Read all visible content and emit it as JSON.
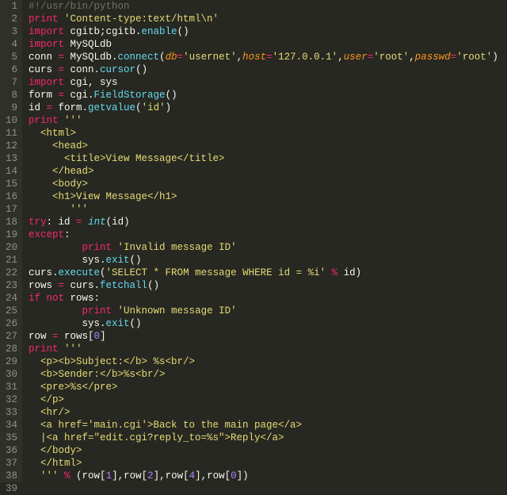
{
  "lines": [
    {
      "n": 1,
      "tokens": [
        [
          "c-comment",
          "#!/usr/bin/python"
        ]
      ]
    },
    {
      "n": 2,
      "tokens": [
        [
          "c-keyword",
          "print"
        ],
        [
          "c-default",
          " "
        ],
        [
          "c-string",
          "'Content-type:text/html\\n'"
        ]
      ]
    },
    {
      "n": 3,
      "tokens": [
        [
          "c-keyword",
          "import"
        ],
        [
          "c-default",
          " cgitb;cgitb."
        ],
        [
          "c-func",
          "enable"
        ],
        [
          "c-default",
          "()"
        ]
      ]
    },
    {
      "n": 4,
      "tokens": [
        [
          "c-keyword",
          "import"
        ],
        [
          "c-default",
          " MySQLdb"
        ]
      ]
    },
    {
      "n": 5,
      "tokens": [
        [
          "c-default",
          "conn "
        ],
        [
          "c-op",
          "="
        ],
        [
          "c-default",
          " MySQLdb."
        ],
        [
          "c-func",
          "connect"
        ],
        [
          "c-default",
          "("
        ],
        [
          "c-param",
          "db"
        ],
        [
          "c-op",
          "="
        ],
        [
          "c-string",
          "'usernet'"
        ],
        [
          "c-default",
          ","
        ],
        [
          "c-param",
          "host"
        ],
        [
          "c-op",
          "="
        ],
        [
          "c-string",
          "'127.0.0.1'"
        ],
        [
          "c-default",
          ","
        ],
        [
          "c-param",
          "user"
        ],
        [
          "c-op",
          "="
        ],
        [
          "c-string",
          "'root'"
        ],
        [
          "c-default",
          ","
        ],
        [
          "c-param",
          "passwd"
        ],
        [
          "c-op",
          "="
        ],
        [
          "c-string",
          "'root'"
        ],
        [
          "c-default",
          ")"
        ]
      ]
    },
    {
      "n": 6,
      "tokens": [
        [
          "c-default",
          "curs "
        ],
        [
          "c-op",
          "="
        ],
        [
          "c-default",
          " conn."
        ],
        [
          "c-func",
          "cursor"
        ],
        [
          "c-default",
          "()"
        ]
      ]
    },
    {
      "n": 7,
      "tokens": [
        [
          "c-keyword",
          "import"
        ],
        [
          "c-default",
          " cgi, sys"
        ]
      ]
    },
    {
      "n": 8,
      "tokens": [
        [
          "c-default",
          "form "
        ],
        [
          "c-op",
          "="
        ],
        [
          "c-default",
          " cgi."
        ],
        [
          "c-func",
          "FieldStorage"
        ],
        [
          "c-default",
          "()"
        ]
      ]
    },
    {
      "n": 9,
      "tokens": [
        [
          "c-default",
          "id "
        ],
        [
          "c-op",
          "="
        ],
        [
          "c-default",
          " form."
        ],
        [
          "c-func",
          "getvalue"
        ],
        [
          "c-default",
          "("
        ],
        [
          "c-string",
          "'id'"
        ],
        [
          "c-default",
          ")"
        ]
      ]
    },
    {
      "n": 10,
      "tokens": [
        [
          "c-keyword",
          "print"
        ],
        [
          "c-default",
          " "
        ],
        [
          "c-string",
          "'''"
        ]
      ]
    },
    {
      "n": 11,
      "tokens": [
        [
          "c-string",
          "  <html>"
        ]
      ]
    },
    {
      "n": 12,
      "tokens": [
        [
          "c-string",
          "    <head>"
        ]
      ]
    },
    {
      "n": 13,
      "tokens": [
        [
          "c-string",
          "      <title>View Message</title>"
        ]
      ]
    },
    {
      "n": 14,
      "tokens": [
        [
          "c-string",
          "    </head>"
        ]
      ]
    },
    {
      "n": 15,
      "tokens": [
        [
          "c-string",
          "    <body>"
        ]
      ]
    },
    {
      "n": 16,
      "tokens": [
        [
          "c-string",
          "    <h1>View Message</h1>"
        ]
      ]
    },
    {
      "n": 17,
      "tokens": [
        [
          "c-string",
          "       '''"
        ]
      ]
    },
    {
      "n": 18,
      "tokens": [
        [
          "c-keyword",
          "try"
        ],
        [
          "c-default",
          ": id "
        ],
        [
          "c-op",
          "="
        ],
        [
          "c-default",
          " "
        ],
        [
          "c-builtin",
          "int"
        ],
        [
          "c-default",
          "(id)"
        ]
      ]
    },
    {
      "n": 19,
      "tokens": [
        [
          "c-keyword",
          "except"
        ],
        [
          "c-default",
          ":"
        ]
      ]
    },
    {
      "n": 20,
      "tokens": [
        [
          "c-default",
          "         "
        ],
        [
          "c-keyword",
          "print"
        ],
        [
          "c-default",
          " "
        ],
        [
          "c-string",
          "'Invalid message ID'"
        ]
      ]
    },
    {
      "n": 21,
      "tokens": [
        [
          "c-default",
          "         sys."
        ],
        [
          "c-func",
          "exit"
        ],
        [
          "c-default",
          "()"
        ]
      ]
    },
    {
      "n": 22,
      "tokens": [
        [
          "c-default",
          "curs."
        ],
        [
          "c-func",
          "execute"
        ],
        [
          "c-default",
          "("
        ],
        [
          "c-string",
          "'SELECT * FROM message WHERE id = %i'"
        ],
        [
          "c-default",
          " "
        ],
        [
          "c-op",
          "%"
        ],
        [
          "c-default",
          " id)"
        ]
      ]
    },
    {
      "n": 23,
      "tokens": [
        [
          "c-default",
          "rows "
        ],
        [
          "c-op",
          "="
        ],
        [
          "c-default",
          " curs."
        ],
        [
          "c-func",
          "fetchall"
        ],
        [
          "c-default",
          "()"
        ]
      ]
    },
    {
      "n": 24,
      "tokens": [
        [
          "c-keyword",
          "if"
        ],
        [
          "c-default",
          " "
        ],
        [
          "c-keyword",
          "not"
        ],
        [
          "c-default",
          " rows:"
        ]
      ]
    },
    {
      "n": 25,
      "tokens": [
        [
          "c-default",
          "         "
        ],
        [
          "c-keyword",
          "print"
        ],
        [
          "c-default",
          " "
        ],
        [
          "c-string",
          "'Unknown message ID'"
        ]
      ]
    },
    {
      "n": 26,
      "tokens": [
        [
          "c-default",
          "         sys."
        ],
        [
          "c-func",
          "exit"
        ],
        [
          "c-default",
          "()"
        ]
      ]
    },
    {
      "n": 27,
      "tokens": [
        [
          "c-default",
          "row "
        ],
        [
          "c-op",
          "="
        ],
        [
          "c-default",
          " rows["
        ],
        [
          "c-number",
          "0"
        ],
        [
          "c-default",
          "]"
        ]
      ]
    },
    {
      "n": 28,
      "tokens": [
        [
          "c-keyword",
          "print"
        ],
        [
          "c-default",
          " "
        ],
        [
          "c-string",
          "'''"
        ]
      ]
    },
    {
      "n": 29,
      "tokens": [
        [
          "c-string",
          "  <p><b>Subject:</b> %s<br/>"
        ]
      ]
    },
    {
      "n": 30,
      "tokens": [
        [
          "c-string",
          "  <b>Sender:</b>%s<br/>"
        ]
      ]
    },
    {
      "n": 31,
      "tokens": [
        [
          "c-string",
          "  <pre>%s</pre>"
        ]
      ]
    },
    {
      "n": 32,
      "tokens": [
        [
          "c-string",
          "  </p>"
        ]
      ]
    },
    {
      "n": 33,
      "tokens": [
        [
          "c-string",
          "  <hr/>"
        ]
      ]
    },
    {
      "n": 34,
      "tokens": [
        [
          "c-string",
          "  <a href='main.cgi'>Back to the main page</a>"
        ]
      ]
    },
    {
      "n": 35,
      "tokens": [
        [
          "c-string",
          "  |<a href=\"edit.cgi?reply_to=%s\">Reply</a>"
        ]
      ]
    },
    {
      "n": 36,
      "tokens": [
        [
          "c-string",
          "  </body>"
        ]
      ]
    },
    {
      "n": 37,
      "tokens": [
        [
          "c-string",
          "  </html>"
        ]
      ]
    },
    {
      "n": 38,
      "tokens": [
        [
          "c-string",
          "  '''"
        ],
        [
          "c-default",
          " "
        ],
        [
          "c-op",
          "%"
        ],
        [
          "c-default",
          " (row["
        ],
        [
          "c-number",
          "1"
        ],
        [
          "c-default",
          "],row["
        ],
        [
          "c-number",
          "2"
        ],
        [
          "c-default",
          "],row["
        ],
        [
          "c-number",
          "4"
        ],
        [
          "c-default",
          "],row["
        ],
        [
          "c-number",
          "0"
        ],
        [
          "c-default",
          "])"
        ]
      ]
    },
    {
      "n": 39,
      "tokens": []
    }
  ]
}
